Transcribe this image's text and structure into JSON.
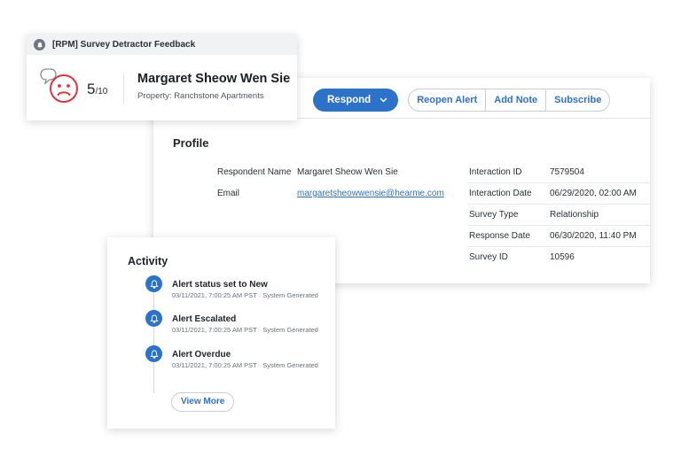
{
  "alert": {
    "header": "[RPM] Survey Detractor Feedback",
    "score": "5",
    "score_total": "/10",
    "customer_name": "Margaret Sheow Wen Sie",
    "property_label": "Property:",
    "property_value": "Ranchstone Apartments"
  },
  "toolbar": {
    "respond": "Respond",
    "reopen": "Reopen Alert",
    "add_note": "Add Note",
    "subscribe": "Subscribe"
  },
  "profile": {
    "title": "Profile",
    "left": [
      {
        "label": "Respondent Name",
        "value": "Margaret Sheow Wen Sie"
      },
      {
        "label": "Email",
        "value": "margaretsheowwensie@hearme.com"
      }
    ],
    "right": [
      {
        "label": "Interaction ID",
        "value": "7579504"
      },
      {
        "label": "Interaction Date",
        "value": "06/29/2020, 02:00 AM"
      },
      {
        "label": "Survey Type",
        "value": "Relationship"
      },
      {
        "label": "Response Date",
        "value": "06/30/2020, 11:40 PM"
      },
      {
        "label": "Survey ID",
        "value": "10596"
      }
    ]
  },
  "activity": {
    "title": "Activity",
    "events": [
      {
        "title": "Alert status set to New",
        "meta": "03/11/2021, 7:00:25 AM PST · System Generated"
      },
      {
        "title": "Alert Escalated",
        "meta": "03/11/2021, 7:00:25 AM PST · System Generated"
      },
      {
        "title": "Alert Overdue",
        "meta": "03/11/2021, 7:00:25 AM PST · System Generated"
      }
    ],
    "view_more": "View More"
  },
  "icons": {
    "header": "bell-icon",
    "score": "sad-face-icon",
    "events": "bell-icon",
    "respond": "chevron-down-icon"
  },
  "colors": {
    "accent": "#2d72c9",
    "detractor": "#e0333e"
  }
}
